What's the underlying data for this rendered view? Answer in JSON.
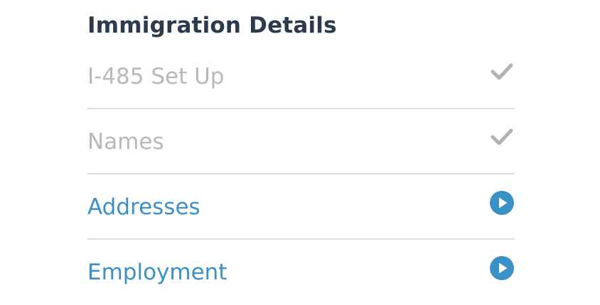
{
  "section": {
    "title": "Immigration Details"
  },
  "steps": [
    {
      "label": "I-485 Set Up",
      "status": "completed",
      "icon": "checkmark-icon"
    },
    {
      "label": "Names",
      "status": "completed",
      "icon": "checkmark-icon"
    },
    {
      "label": "Addresses",
      "status": "pending",
      "icon": "play-circle-icon"
    },
    {
      "label": "Employment",
      "status": "pending",
      "icon": "play-circle-icon"
    }
  ],
  "colors": {
    "title": "#2b3a4c",
    "completed_text": "#b8b8b8",
    "completed_icon": "#b3b3b3",
    "active_text": "#3b90c6",
    "active_icon": "#3b90c6",
    "divider": "#dcdcdc"
  }
}
